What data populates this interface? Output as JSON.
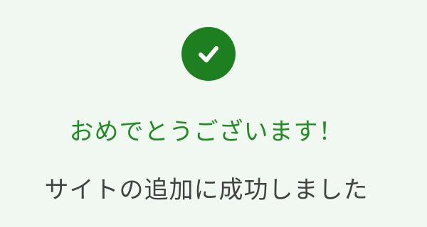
{
  "success": {
    "icon": "check-circle-icon",
    "headline": "おめでとうございます！",
    "message": "サイトの追加に成功しました"
  },
  "colors": {
    "background": "#f1f8f2",
    "accent": "#1e7f20",
    "headline": "#238a24",
    "message": "#424242",
    "icon_check": "#ffffff"
  }
}
